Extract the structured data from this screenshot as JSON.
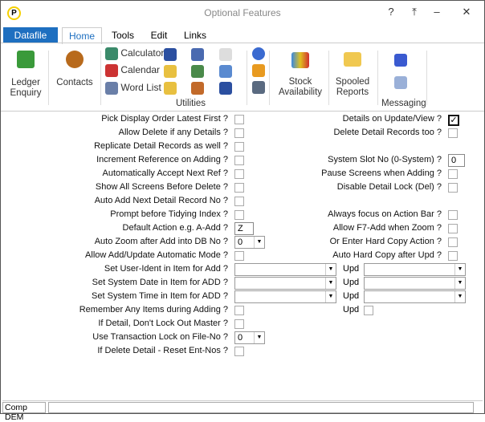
{
  "window": {
    "title": "Optional Features",
    "help": "?",
    "restore": "⤒",
    "minimize": "–",
    "close": "✕",
    "logo": "P"
  },
  "tabs": [
    "Datafile",
    "Home",
    "Tools",
    "Edit",
    "Links"
  ],
  "ribbon": {
    "ledger": "Ledger\nEnquiry",
    "contacts": "Contacts",
    "calculator": "Calculator",
    "calendar": "Calendar",
    "wordlist": "Word List",
    "utilities": "Utilities",
    "stock": "Stock\nAvailability",
    "spooled": "Spooled\nReports",
    "messaging": "Messaging"
  },
  "left_fields": [
    {
      "label": "Pick Display Order Latest First ?",
      "type": "check",
      "checked": false
    },
    {
      "label": "Allow Delete if any Details ?",
      "type": "check",
      "checked": false
    },
    {
      "label": "Replicate Detail Records as well ?",
      "type": "check",
      "checked": false
    },
    {
      "label": "Increment Reference on Adding ?",
      "type": "check",
      "checked": false
    },
    {
      "label": "Automatically Accept Next Ref ?",
      "type": "check",
      "checked": false
    },
    {
      "label": "Show All Screens Before Delete ?",
      "type": "check",
      "checked": false
    },
    {
      "label": "Auto Add Next Detail Record No ?",
      "type": "check",
      "checked": false
    },
    {
      "label": "Prompt before Tidying Index ?",
      "type": "check",
      "checked": false
    },
    {
      "label": "Default Action e.g. A-Add ?",
      "type": "text",
      "value": "Z"
    },
    {
      "label": "Auto Zoom after Add into DB No ?",
      "type": "smallcombo",
      "value": "0"
    },
    {
      "label": "Allow Add/Update Automatic Mode ?",
      "type": "check",
      "checked": false
    },
    {
      "label": "Set User-Ident in Item for Add ?",
      "type": "combo",
      "value": ""
    },
    {
      "label": "Set System Date in Item for ADD ?",
      "type": "combo",
      "value": ""
    },
    {
      "label": "Set System Time in Item for ADD ?",
      "type": "combo",
      "value": ""
    },
    {
      "label": "Remember Any Items during Adding ?",
      "type": "check",
      "checked": false
    },
    {
      "label": "If Detail, Don't Lock Out Master ?",
      "type": "check",
      "checked": false
    },
    {
      "label": "Use Transaction Lock on File-No ?",
      "type": "smallcombo",
      "value": "0"
    },
    {
      "label": "If Delete Detail - Reset Ent-Nos ?",
      "type": "check",
      "checked": false
    }
  ],
  "right_fields": [
    {
      "row": 0,
      "label": "Details on Update/View ?",
      "type": "check",
      "checked": true
    },
    {
      "row": 1,
      "label": "Delete Detail Records too ?",
      "type": "check",
      "checked": false
    },
    {
      "row": 3,
      "label": "System Slot No (0-System) ?",
      "type": "text",
      "value": "0"
    },
    {
      "row": 4,
      "label": "Pause Screens when Adding ?",
      "type": "check",
      "checked": false
    },
    {
      "row": 5,
      "label": "Disable Detail Lock (Del) ?",
      "type": "check",
      "checked": false
    },
    {
      "row": 7,
      "label": "Always focus on Action Bar ?",
      "type": "check",
      "checked": false
    },
    {
      "row": 8,
      "label": "Allow F7-Add when Zoom ?",
      "type": "check",
      "checked": false
    },
    {
      "row": 9,
      "label": "Or Enter Hard Copy Action ?",
      "type": "check",
      "checked": false
    },
    {
      "row": 10,
      "label": "Auto Hard Copy after Upd ?",
      "type": "check",
      "checked": false
    }
  ],
  "upd_fields": [
    {
      "row": 11,
      "label": "Upd",
      "type": "combo",
      "value": ""
    },
    {
      "row": 12,
      "label": "Upd",
      "type": "combo",
      "value": ""
    },
    {
      "row": 13,
      "label": "Upd",
      "type": "combo",
      "value": ""
    },
    {
      "row": 14,
      "label": "Upd",
      "type": "check",
      "checked": false
    }
  ],
  "status": {
    "company": "Comp DEM",
    "message": ""
  }
}
